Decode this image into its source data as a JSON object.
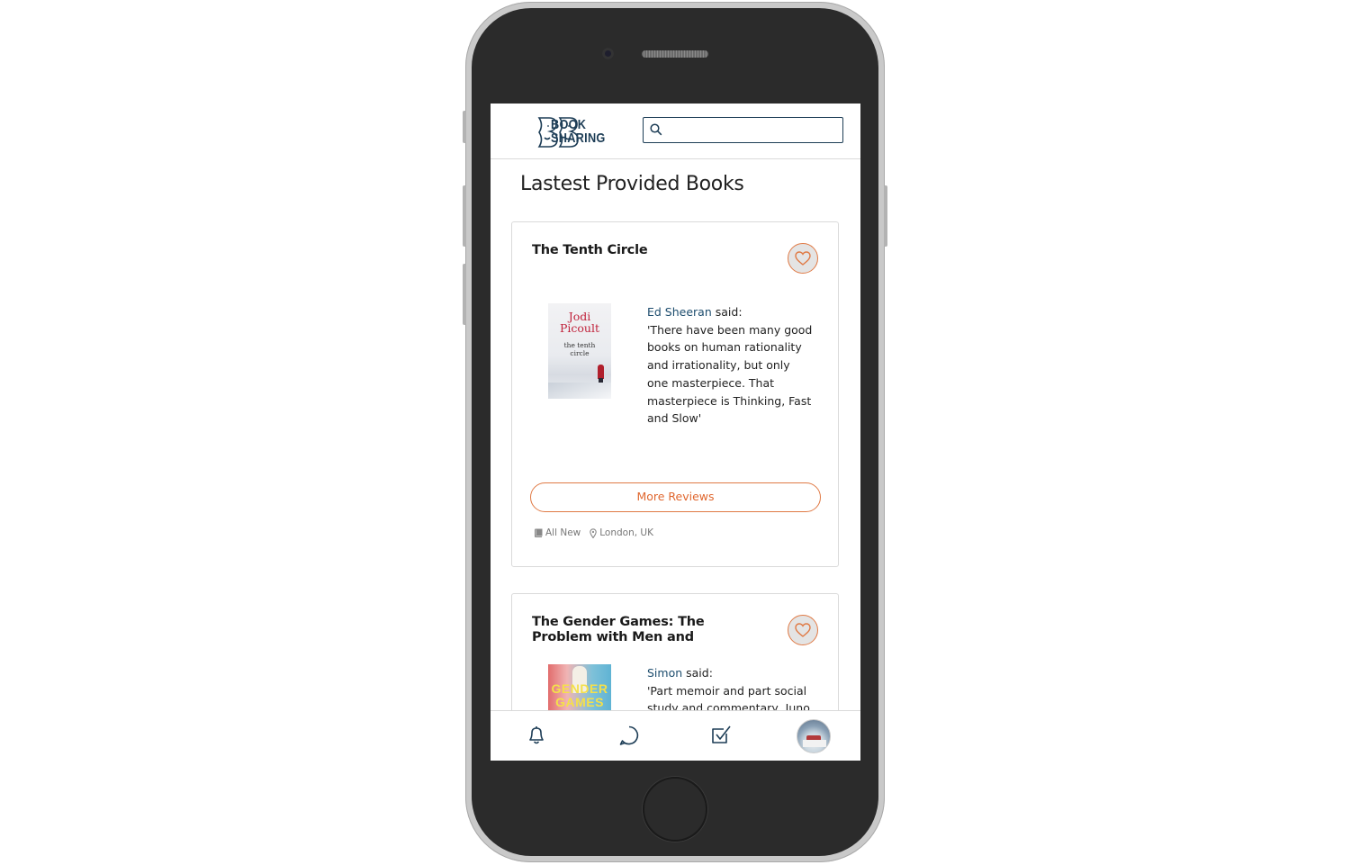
{
  "app": {
    "logo_line1": "BOOK",
    "logo_line2": "SHARING"
  },
  "search": {
    "placeholder": "",
    "value": ""
  },
  "page": {
    "title": "Lastest Provided Books"
  },
  "books": [
    {
      "title": "The Tenth Circle",
      "cover_author": "Jodi Picoult",
      "cover_title": "the tenth circle",
      "reviewer": "Ed Sheeran",
      "said": " said:",
      "quote": "'There have been many good books on human rationality and irrationality, but only one masterpiece. That masterpiece is Thinking, Fast and Slow'",
      "more_label": "More Reviews",
      "condition": "All New",
      "location": "London, UK"
    },
    {
      "title": "The Gender Games: The Problem with Men and",
      "cover_title": "GENDER GAMES",
      "reviewer": "Simon",
      "said": " said:",
      "quote": "'Part memoir and part social study and commentary, Juno"
    }
  ],
  "nav": {
    "items": [
      "bell-icon",
      "chat-icon",
      "checkbox-icon",
      "avatar"
    ]
  },
  "colors": {
    "brand": "#1d3d56",
    "accent": "#e07a45",
    "link": "#1d4d6e"
  }
}
